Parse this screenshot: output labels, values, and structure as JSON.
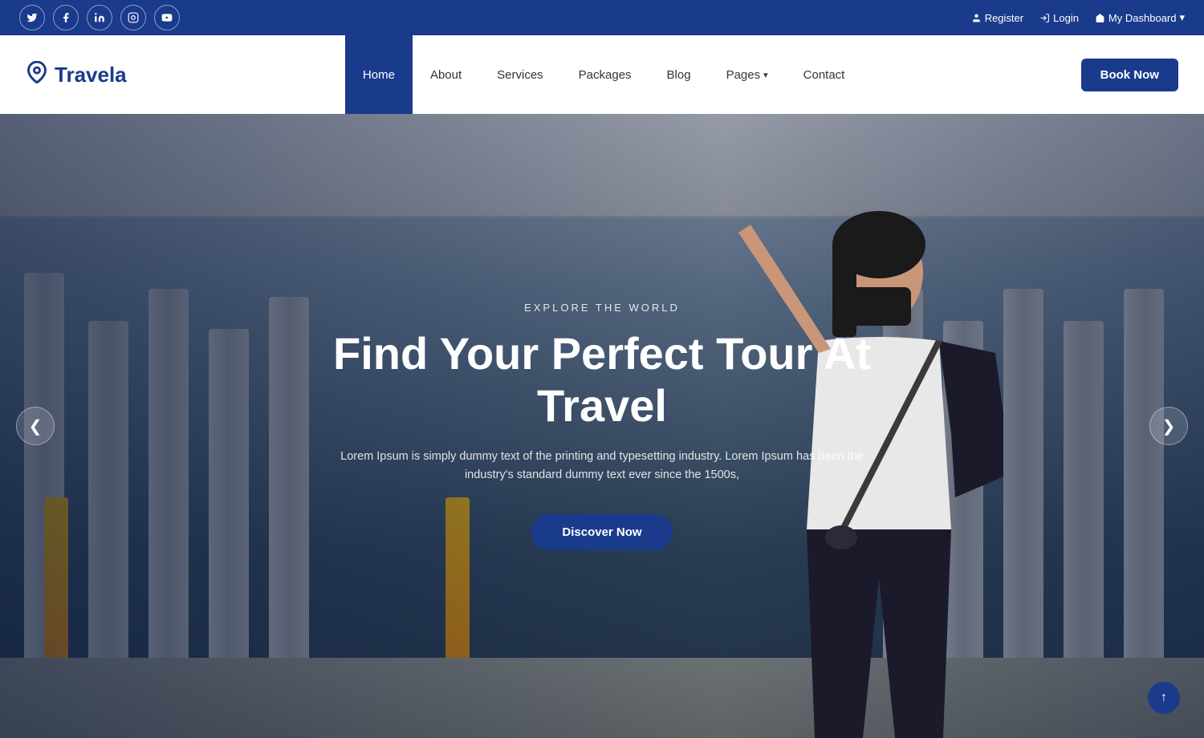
{
  "topBar": {
    "social": [
      {
        "name": "twitter",
        "icon": "𝕏",
        "unicode": "🐦"
      },
      {
        "name": "facebook",
        "icon": "f"
      },
      {
        "name": "linkedin",
        "icon": "in"
      },
      {
        "name": "instagram",
        "icon": "📷"
      },
      {
        "name": "youtube",
        "icon": "▶"
      }
    ],
    "rightLinks": [
      {
        "label": "Register",
        "icon": "person"
      },
      {
        "label": "Login",
        "icon": "login"
      },
      {
        "label": "My Dashboard",
        "icon": "home",
        "hasDropdown": true
      }
    ]
  },
  "navbar": {
    "logo": {
      "text": "Travela",
      "icon": "📍"
    },
    "navItems": [
      {
        "label": "Home",
        "active": true
      },
      {
        "label": "About",
        "active": false
      },
      {
        "label": "Services",
        "active": false
      },
      {
        "label": "Packages",
        "active": false
      },
      {
        "label": "Blog",
        "active": false
      },
      {
        "label": "Pages",
        "active": false,
        "hasDropdown": true
      },
      {
        "label": "Contact",
        "active": false
      }
    ],
    "bookNow": "Book Now"
  },
  "hero": {
    "subtitle": "EXPLORE THE WORLD",
    "title": "Find Your Perfect Tour At Travel",
    "description": "Lorem Ipsum is simply dummy text of the printing and typesetting industry. Lorem Ipsum has been the industry's standard dummy text ever since the 1500s,",
    "discoverBtn": "Discover Now",
    "prevArrow": "❮",
    "nextArrow": "❯"
  },
  "scrollTop": "↑",
  "colors": {
    "brand": "#1a3a8c",
    "topBar": "#1a3a8c",
    "white": "#ffffff"
  }
}
